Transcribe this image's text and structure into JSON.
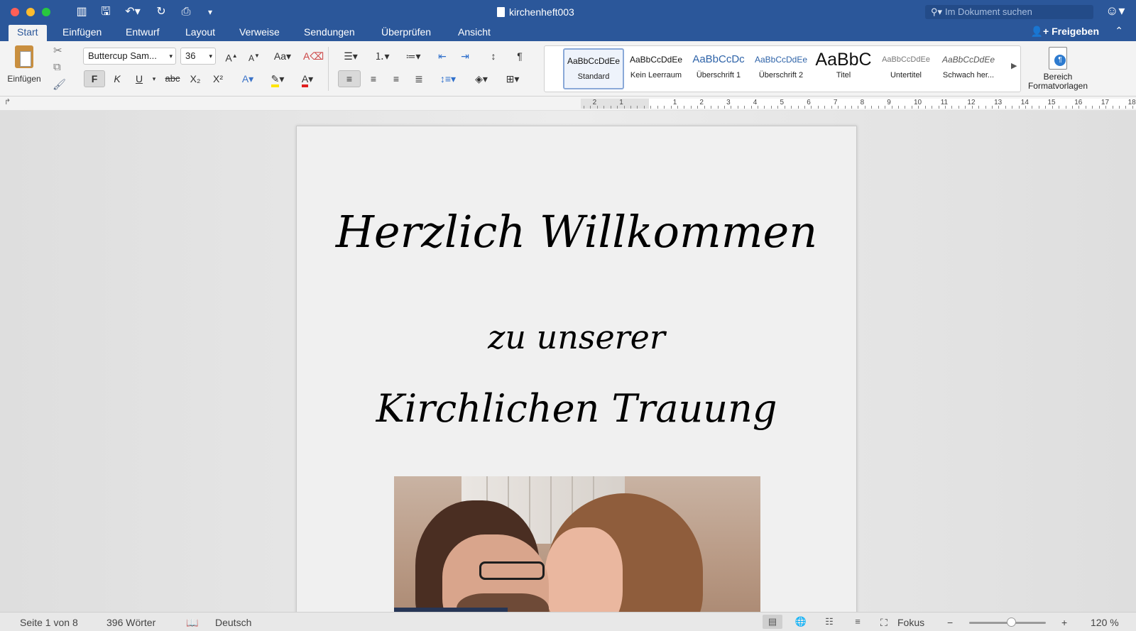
{
  "window": {
    "title": "kirchenheft003",
    "search_placeholder": "Im Dokument suchen"
  },
  "tabs": [
    {
      "label": "Start",
      "active": true
    },
    {
      "label": "Einfügen",
      "active": false
    },
    {
      "label": "Entwurf",
      "active": false
    },
    {
      "label": "Layout",
      "active": false
    },
    {
      "label": "Verweise",
      "active": false
    },
    {
      "label": "Sendungen",
      "active": false
    },
    {
      "label": "Überprüfen",
      "active": false
    },
    {
      "label": "Ansicht",
      "active": false
    }
  ],
  "share_label": "Freigeben",
  "ribbon": {
    "paste_label": "Einfügen",
    "font_name": "Buttercup Sam...",
    "font_size": "36",
    "bold": "F",
    "italic": "K",
    "underline": "U",
    "strike": "abc",
    "subscript": "X₂",
    "superscript": "X²",
    "styles": [
      {
        "preview": "AaBbCcDdEe",
        "name": "Standard",
        "selected": true
      },
      {
        "preview": "AaBbCcDdEe",
        "name": "Kein Leerraum",
        "selected": false
      },
      {
        "preview": "AaBbCcDc",
        "name": "Überschrift 1",
        "selected": false
      },
      {
        "preview": "AaBbCcDdEe",
        "name": "Überschrift 2",
        "selected": false
      },
      {
        "preview": "AaBbC",
        "name": "Titel",
        "selected": false
      },
      {
        "preview": "AaBbCcDdEe",
        "name": "Untertitel",
        "selected": false
      },
      {
        "preview": "AaBbCcDdEe",
        "name": "Schwach her...",
        "selected": false
      }
    ],
    "styles_pane_line1": "Bereich",
    "styles_pane_line2": "Formatvorlagen"
  },
  "ruler": {
    "numbers": [
      "2",
      "1",
      "1",
      "2",
      "3",
      "4",
      "5",
      "6",
      "7",
      "8",
      "9",
      "10",
      "11",
      "12",
      "13",
      "14",
      "15",
      "16",
      "17",
      "18"
    ]
  },
  "document": {
    "line1": "Herzlich Willkommen",
    "line2": "zu unserer",
    "line3": "Kirchlichen Trauung"
  },
  "status": {
    "page": "Seite 1 von 8",
    "words": "396 Wörter",
    "language": "Deutsch",
    "focus": "Fokus",
    "zoom": "120 %",
    "zoom_level_fraction": 0.55
  },
  "colors": {
    "brand": "#2b579a",
    "font_color": "#e02020",
    "highlight": "#ffe500"
  }
}
